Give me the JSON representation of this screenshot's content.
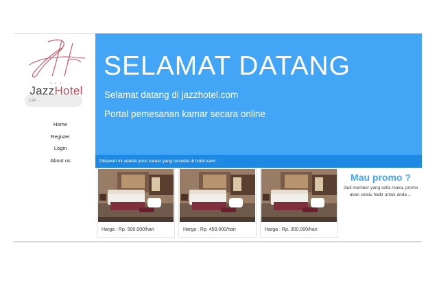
{
  "brand": {
    "name_prefix": "Jazz",
    "name_suffix": "Hotel",
    "dots": "• • •"
  },
  "search": {
    "placeholder": "Cari ..."
  },
  "nav": {
    "items": [
      "Home",
      "Register",
      "Login",
      "About us"
    ]
  },
  "hero": {
    "title": "SELAMAT DATANG",
    "line1": "Selamat datang di jazzhotel.com",
    "line2": "Portal pemesanan kamar secara online"
  },
  "info_bar": "Dibawah ini adalah jenis kamar yang tersedia di hotel kami :",
  "rooms": [
    {
      "price": "Harga : Rp. 500.000/hari"
    },
    {
      "price": "Harga : Rp. 450.000/hari"
    },
    {
      "price": "Harga : Rp. 300.000/hari"
    }
  ],
  "promo": {
    "title": "Mau promo ?",
    "text": "Jadi member yang setia maka, promo akan selalu hadir untuk anda ..."
  },
  "colors": {
    "hero": "#42a5f5",
    "info_bar": "#1e88e5",
    "logo_accent": "#c9475a",
    "promo_title": "#42a5f5"
  }
}
